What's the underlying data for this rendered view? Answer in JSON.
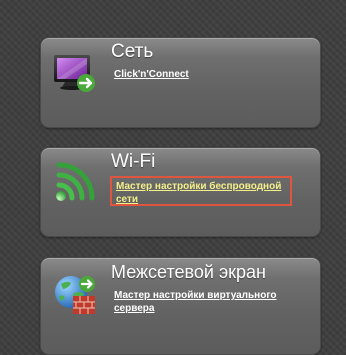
{
  "cards": [
    {
      "title": "Сеть",
      "icon": "network-monitor-icon",
      "link": "Click'n'Connect"
    },
    {
      "title": "Wi-Fi",
      "icon": "wifi-icon",
      "link_line1": "Мастер настройки беспроводной",
      "link_line2": "сети",
      "highlight_color": "#e0553f",
      "link_color": "#f3f08a"
    },
    {
      "title": "Межсетевой экран",
      "icon": "firewall-globe-icon",
      "link_line1": "Мастер настройки виртуального",
      "link_line2": "сервера"
    }
  ]
}
